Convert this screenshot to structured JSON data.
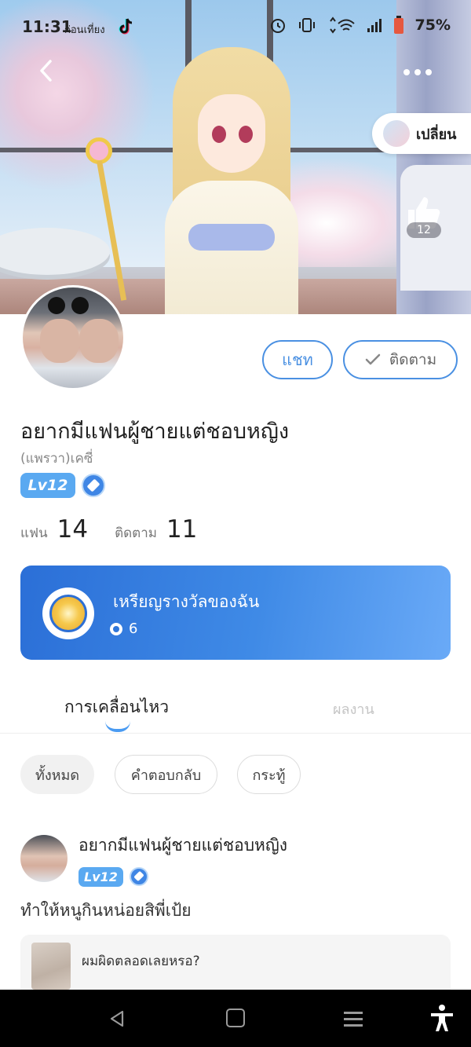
{
  "status_bar": {
    "time": "11:31",
    "time_suffix": "ก่อนเที่ยง",
    "battery": "75%"
  },
  "header": {
    "change_label": "เปลี่ยน",
    "like_count": "12"
  },
  "profile": {
    "name": "อยากมีแฟนผู้ชายแต่ชอบหญิง",
    "alias": "(แพรวา)เคซี่",
    "level": "Lv12",
    "fans_label": "แฟน",
    "fans_count": "14",
    "following_label": "ติดตาม",
    "following_count": "11"
  },
  "actions": {
    "chat_label": "แชท",
    "follow_label": "ติดตาม"
  },
  "medal": {
    "title": "เหรียญรางวัลของฉัน",
    "count": "6"
  },
  "tabs": [
    {
      "label": "การเคลื่อนไหว",
      "active": true
    },
    {
      "label": "ผลงาน",
      "active": false
    }
  ],
  "filters": [
    {
      "label": "ทั้งหมด",
      "selected": true
    },
    {
      "label": "คำตอบกลับ",
      "selected": false
    },
    {
      "label": "กระทู้",
      "selected": false
    }
  ],
  "post": {
    "author": "อยากมีแฟนผู้ชายแต่ชอบหญิง",
    "level": "Lv12",
    "text": "ทำให้หนูกินหน่อยสิพี่เป้ย",
    "quote_text": "ผมผิดตลอดเลยหรอ?"
  },
  "colors": {
    "accent": "#4a90e2",
    "medal_gradient_start": "#2b6fd7",
    "medal_gradient_end": "#6aaaf7",
    "level_badge": "#5aa9f1"
  }
}
